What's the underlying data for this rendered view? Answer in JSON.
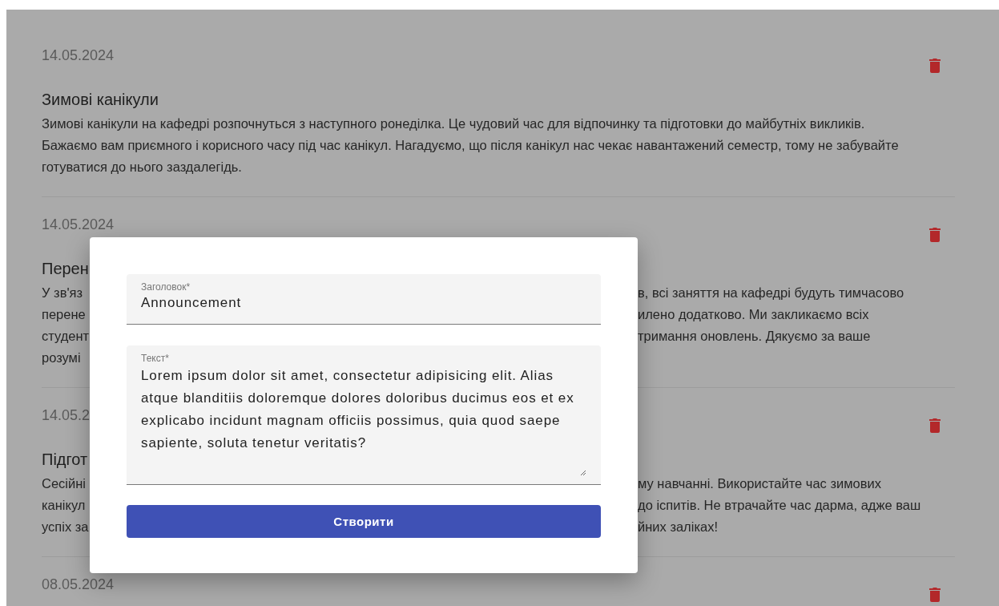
{
  "posts": [
    {
      "kind": "full",
      "date": "14.05.2024",
      "title": "Зимові канікули",
      "body": "Зимові канікули на кафедрі розпочнуться з наступного ронеділка. Це чудовий час для відпочинку та підготовки до майбутніх викликів. Бажаємо вам приємного і корисного часу під час канікул. Нагадуємо, що після канікул нас чекає навантажений семестр, тому не забувайте готуватися до нього заздалегідь."
    },
    {
      "kind": "covered",
      "date": "14.05.2024",
      "title": "Перен",
      "lines": [
        {
          "left": "У зв'яз",
          "right": "в, всі заняття на кафедрі будуть тимчасово"
        },
        {
          "left": "перене",
          "right": "илено додатково. Ми закликаємо всіх"
        },
        {
          "left": "студент",
          "right": "тримання оновлень. Дякуємо за ваше"
        },
        {
          "left": "розумі"
        }
      ]
    },
    {
      "kind": "covered",
      "date": "14.05.2",
      "title": "Підгот",
      "lines": [
        {
          "left": "Сесійні",
          "right": "му навчанні. Використайте час зимових"
        },
        {
          "left": "канікул",
          "right": "до іспитів. Не втрачайте час дарма, адже ваш"
        },
        {
          "left": "успіх за",
          "right": "йних заліках!"
        }
      ]
    },
    {
      "kind": "covered",
      "date": "08.05.2024"
    }
  ],
  "dialog": {
    "title_field": {
      "label": "Заголовок*",
      "value": "Announcement"
    },
    "text_field": {
      "label": "Текст*",
      "value": "Lorem ipsum dolor sit amet, consectetur adipisicing elit. Alias atque blanditiis doloremque dolores doloribus ducimus eos et ex explicabo incidunt magnam officiis possimus, quia quod saepe sapiente, soluta tenetur veritatis?"
    },
    "submit": "Створити"
  }
}
